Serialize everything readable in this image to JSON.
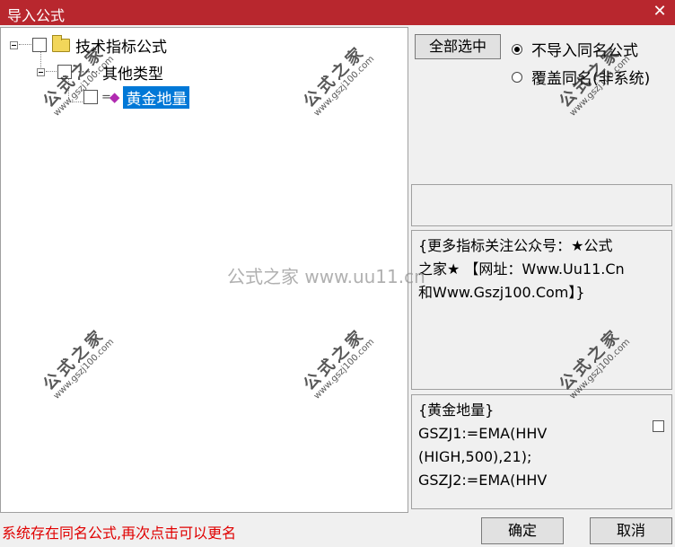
{
  "window": {
    "title": "导入公式",
    "close_glyph": "✕"
  },
  "tree": {
    "root": {
      "label": "技术指标公式",
      "icon": "folder-icon"
    },
    "child": {
      "label": "其他类型",
      "icon": "dots-icon",
      "glyph": "⋯⋯"
    },
    "leaf": {
      "label": "黄金地量",
      "icon": "gem-icon",
      "glyph": "◆",
      "selected": true
    }
  },
  "buttons": {
    "select_all": "全部选中",
    "ok": "确定",
    "cancel": "取消"
  },
  "options": {
    "no_import_same_name": {
      "label": "不导入同名公式",
      "selected": true
    },
    "overwrite_same_name": {
      "label": "覆盖同名(非系统)",
      "selected": false
    }
  },
  "info": {
    "line1": "{更多指标关注公众号：★公式",
    "line2": "之家★ 【网址：Www.Uu11.Cn",
    "line3": "和Www.Gszj100.Com】}"
  },
  "formula": {
    "line1": "{黄金地量}",
    "line2": "GSZJ1:=EMA(HHV",
    "line3": "(HIGH,500),21);",
    "line4": "GSZJ2:=EMA(HHV"
  },
  "status_text": "系统存在同名公式,再次点击可以更名",
  "watermark": {
    "text": "公式之家",
    "url": "www.gszj100.com",
    "center": "公式之家 www.uu11.cn"
  },
  "colors": {
    "title_bar": "#b8272e",
    "selection": "#0078d7",
    "status": "#e00000"
  }
}
